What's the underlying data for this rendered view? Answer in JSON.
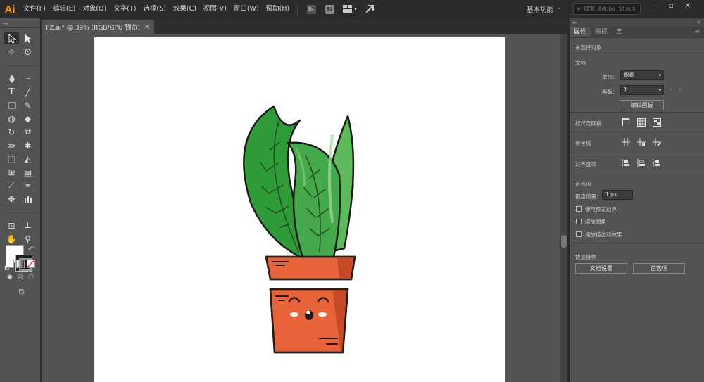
{
  "app": {
    "logo": "Ai",
    "accent_color": "#ff9a00"
  },
  "menu": [
    "文件(F)",
    "编辑(E)",
    "对象(O)",
    "文字(T)",
    "选择(S)",
    "效果(C)",
    "视图(V)",
    "窗口(W)",
    "帮助(H)"
  ],
  "menubar_icons": [
    {
      "icon": "bridge-icon",
      "label": "Br"
    },
    {
      "icon": "stock-icon",
      "label": "St"
    },
    {
      "icon": "arrange-documents-icon",
      "label": ""
    },
    {
      "icon": "gpu-performance-icon",
      "label": ""
    }
  ],
  "workspace": {
    "label": "基本功能"
  },
  "search": {
    "placeholder": "搜索 Adobe Stock"
  },
  "document_tab": {
    "title": "PZ.ai* @ 39% (RGB/GPU 预览)",
    "close": "×"
  },
  "colors": {
    "fill": "#ffffff",
    "stroke": "#1d1d1d",
    "canvas_bg": "#535353",
    "artboard": "#ffffff"
  },
  "right_panel": {
    "tabs": [
      "属性",
      "图层",
      "库"
    ],
    "active_tab": "属性",
    "no_selection": "未选择对象",
    "document": {
      "title": "文档",
      "unit_label": "单位：",
      "unit_value": "像素",
      "artboard_label": "画板：",
      "artboard_value": "1",
      "edit_artboards_btn": "编辑画板"
    },
    "rulers_grids": {
      "title": "标尺与网格"
    },
    "guides": {
      "title": "参考线"
    },
    "align": {
      "title": "对齐选项"
    },
    "preferences": {
      "title": "首选项",
      "keyboard_increment_label": "键盘增量：",
      "keyboard_increment_value": "1 px",
      "checkboxes": [
        "使用预览边界",
        "缩放圆角",
        "缩放描边和效果"
      ]
    },
    "quick_actions": {
      "title": "快速操作",
      "doc_setup_btn": "文档设置",
      "preferences_btn": "首选项"
    }
  }
}
